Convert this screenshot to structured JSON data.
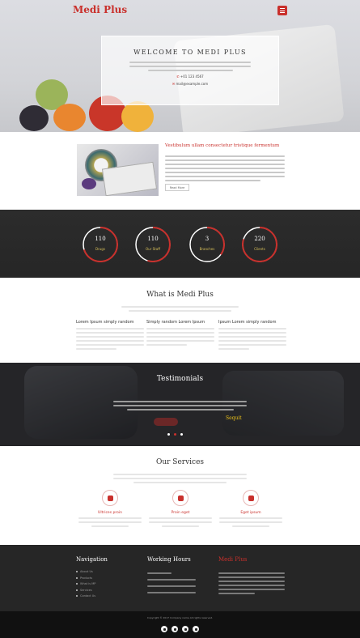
{
  "brand": "Medi Plus",
  "hero": {
    "title": "WELCOME TO MEDI PLUS",
    "phone": "+01 123 4567",
    "email": "mail@example.com"
  },
  "feature": {
    "title": "Vestibulum ullam consectetur tristique fermentum",
    "button": "Read More"
  },
  "counters": [
    {
      "value": "110",
      "label": "Drugs",
      "fraction": 0.7
    },
    {
      "value": "110",
      "label": "Our Staff",
      "fraction": 0.55
    },
    {
      "value": "3",
      "label": "Branches",
      "fraction": 0.35
    },
    {
      "value": "220",
      "label": "Clients",
      "fraction": 0.8
    }
  ],
  "whatis": {
    "title": "What is Medi Plus",
    "columns": [
      {
        "heading": "Lorem Ipsum simply random"
      },
      {
        "heading": "Simply random Lorem Ipsum"
      },
      {
        "heading": "Ipsum Lorem simply random"
      }
    ]
  },
  "testimonials": {
    "title": "Testimonials",
    "author": "Sequit",
    "active_dot": 1
  },
  "services": {
    "title": "Our Services",
    "items": [
      {
        "heading": "Ultrices proin",
        "icon": "user-doctor-icon"
      },
      {
        "heading": "Proin eget",
        "icon": "medical-kit-icon"
      },
      {
        "heading": "Eget ipsum",
        "icon": "ambulance-icon"
      }
    ]
  },
  "footer": {
    "nav_title": "Navigation",
    "nav_items": [
      "About Us",
      "Products",
      "What is MP",
      "Services",
      "Contact Us"
    ],
    "hours_title": "Working Hours",
    "about_title": "Medi Plus",
    "copyright": "Copyright © 2017 Company name All rights reserved.",
    "social": [
      "facebook-icon",
      "twitter-icon",
      "google-plus-icon",
      "linkedin-icon"
    ]
  },
  "colors": {
    "accent": "#c9302c",
    "dark": "#262626",
    "gold": "#d9c15a"
  }
}
